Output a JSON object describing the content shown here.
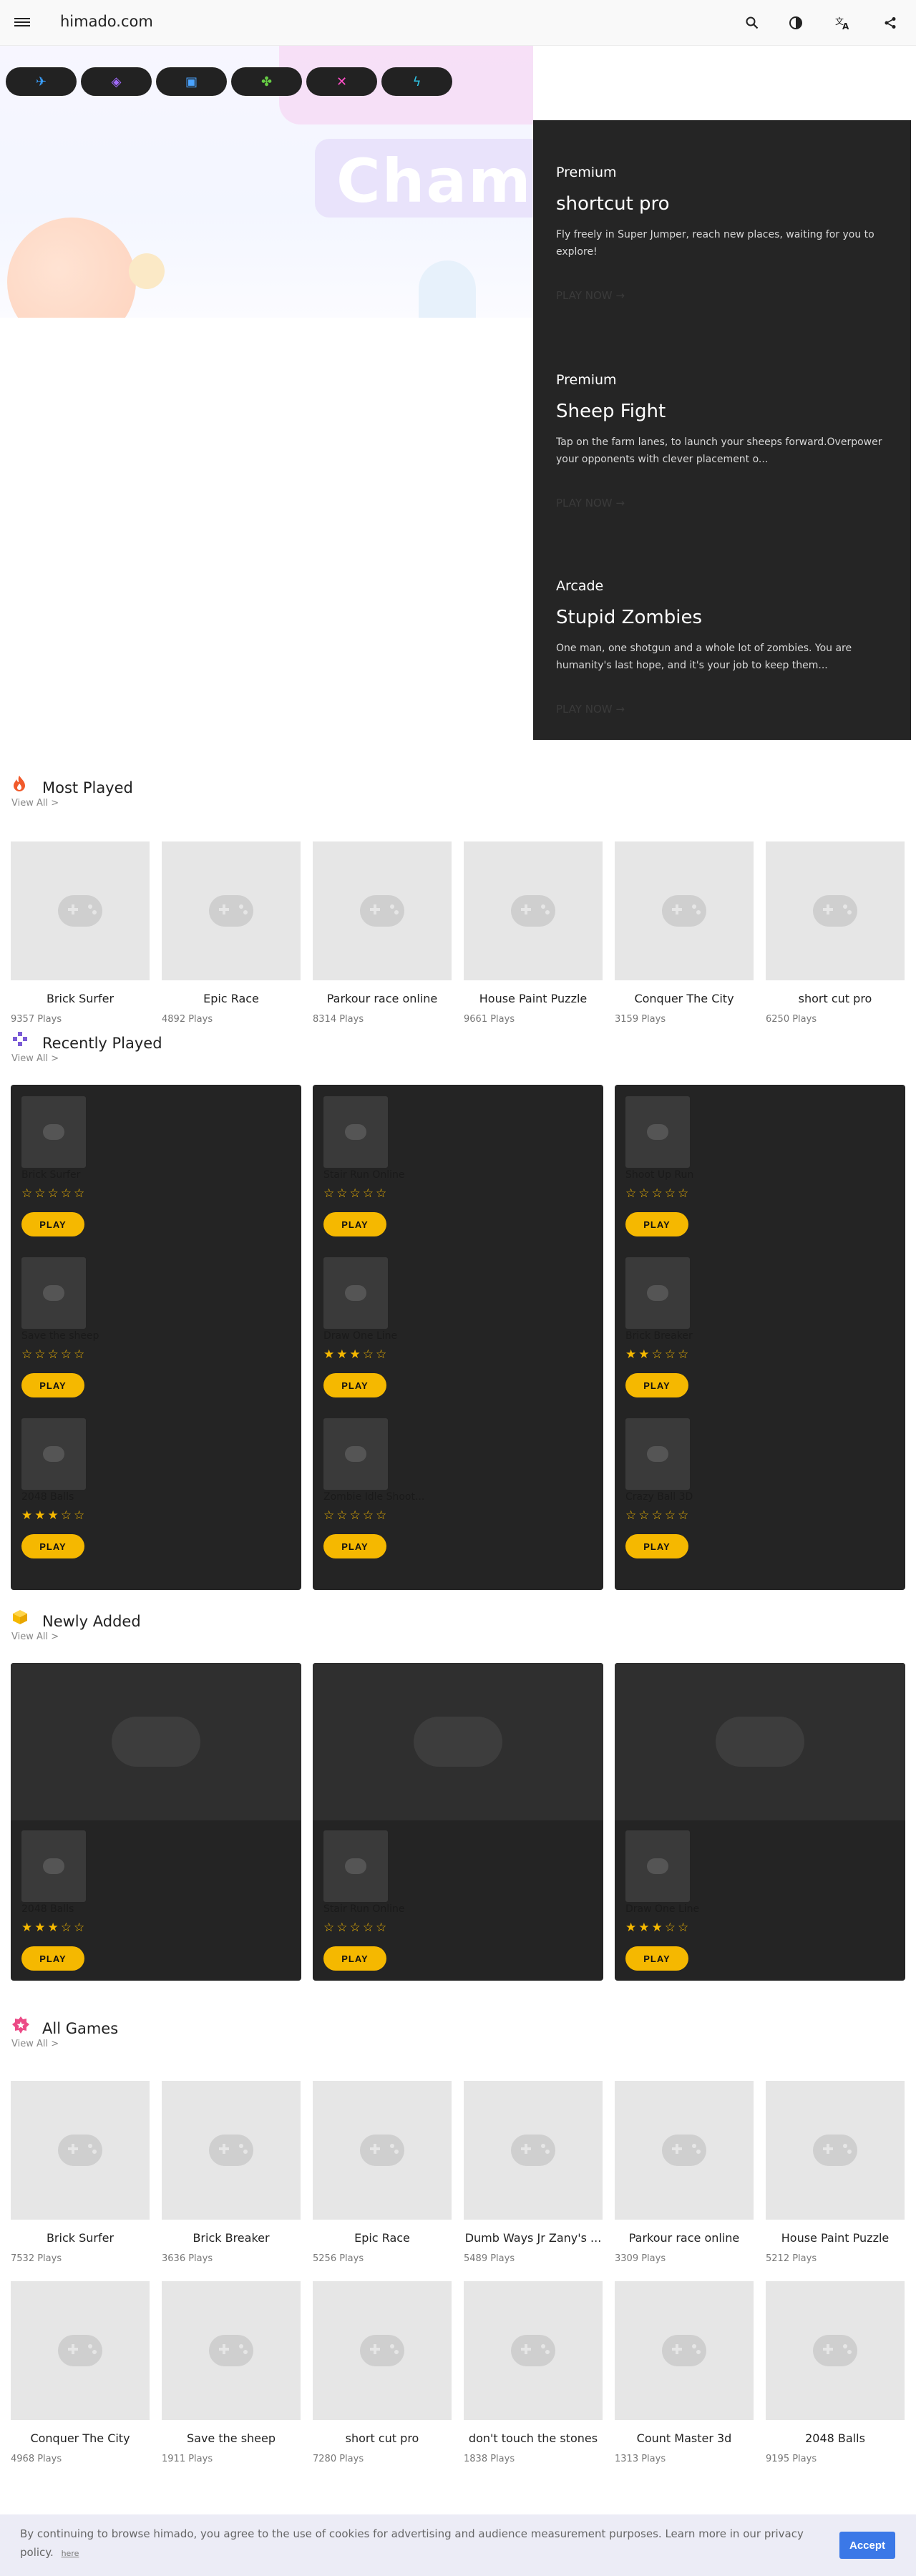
{
  "header": {
    "site_title": "himado.com",
    "icons": [
      "menu-icon",
      "search-icon",
      "contrast-icon",
      "translate-icon",
      "share-icon"
    ]
  },
  "hero": {
    "banner_text": "Cham",
    "category_icons": [
      "rocket-icon",
      "candy-icon",
      "tablet-icon",
      "puzzle-icon",
      "crossed-swords-icon",
      "lightning-icon"
    ],
    "promos": [
      {
        "tag": "Premium",
        "title": "shortcut pro",
        "description": "Fly freely in Super Jumper, reach new places, waiting for you to explore!",
        "cta": "PLAY NOW →"
      },
      {
        "tag": "Premium",
        "title": "Sheep Fight",
        "description": "Tap on the farm lanes, to launch your sheeps forward.Overpower your opponents with clever placement o...",
        "cta": "PLAY NOW →"
      },
      {
        "tag": "Arcade",
        "title": "Stupid Zombies",
        "description": "One man, one shotgun and a whole lot of zombies. You are humanity's last hope, and it's your job to keep them...",
        "cta": "PLAY NOW →"
      }
    ]
  },
  "most_played": {
    "title": "Most Played",
    "view_all": "View All >",
    "icon": "fire-icon",
    "items": [
      {
        "name": "Brick Surfer",
        "plays": "9357 Plays"
      },
      {
        "name": "Epic Race",
        "plays": "4892 Plays"
      },
      {
        "name": "Parkour race online",
        "plays": "8314 Plays"
      },
      {
        "name": "House Paint Puzzle",
        "plays": "9661 Plays"
      },
      {
        "name": "Conquer The City",
        "plays": "3159 Plays"
      },
      {
        "name": "short cut pro",
        "plays": "6250 Plays"
      }
    ]
  },
  "recently_played": {
    "title": "Recently Played",
    "view_all": "View All >",
    "icon": "gamepad-icon",
    "play_label": "PLAY",
    "columns": [
      [
        {
          "name": "Brick Surfer",
          "rating": 0
        },
        {
          "name": "Save the sheep",
          "rating": 0
        },
        {
          "name": "2048 Balls",
          "rating": 3
        }
      ],
      [
        {
          "name": "Stair Run Online",
          "rating": 0
        },
        {
          "name": "Draw One Line",
          "rating": 3
        },
        {
          "name": "Zombie Idle Shoot...",
          "rating": 0
        }
      ],
      [
        {
          "name": "Shoot Up Run",
          "rating": 0
        },
        {
          "name": "Brick Breaker",
          "rating": 2
        },
        {
          "name": "Crazy Ball 3D",
          "rating": 0
        }
      ]
    ]
  },
  "newly_added": {
    "title": "Newly Added",
    "view_all": "View All >",
    "icon": "box-icon",
    "play_label": "PLAY",
    "items": [
      {
        "name": "2048 Balls",
        "rating": 3
      },
      {
        "name": "Stair Run Online",
        "rating": 0
      },
      {
        "name": "Draw One Line",
        "rating": 3
      }
    ]
  },
  "all_games": {
    "title": "All Games",
    "view_all": "View All >",
    "icon": "star-badge-icon",
    "rows": [
      [
        {
          "name": "Brick Surfer",
          "plays": "7532 Plays"
        },
        {
          "name": "Brick Breaker",
          "plays": "3636 Plays"
        },
        {
          "name": "Epic Race",
          "plays": "5256 Plays"
        },
        {
          "name": "Dumb Ways Jr Zany's ...",
          "plays": "5489 Plays"
        },
        {
          "name": "Parkour race online",
          "plays": "3309 Plays"
        },
        {
          "name": "House Paint Puzzle",
          "plays": "5212 Plays"
        }
      ],
      [
        {
          "name": "Conquer The City",
          "plays": "4968 Plays"
        },
        {
          "name": "Save the sheep",
          "plays": "1911 Plays"
        },
        {
          "name": "short cut pro",
          "plays": "7280 Plays"
        },
        {
          "name": "don't touch the stones",
          "plays": "1838 Plays"
        },
        {
          "name": "Count Master 3d",
          "plays": "1313 Plays"
        },
        {
          "name": "2048 Balls",
          "plays": "9195 Plays"
        }
      ]
    ]
  },
  "cookie": {
    "text": "By continuing to browse himado, you agree to the use of cookies for advertising and audience measurement purposes. Learn more in our privacy policy.",
    "link": "here",
    "accept": "Accept"
  },
  "colors": {
    "accent_yellow": "#f5b800",
    "dark_card": "#242424",
    "accept_blue": "#3b78e7"
  }
}
